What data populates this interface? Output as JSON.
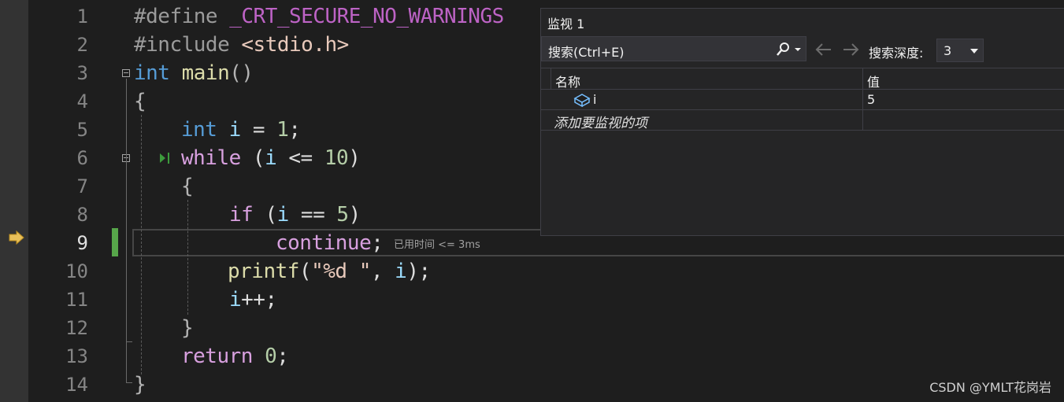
{
  "editor": {
    "line_numbers": [
      "1",
      "2",
      "3",
      "4",
      "5",
      "6",
      "7",
      "8",
      "9",
      "10",
      "11",
      "12",
      "13",
      "14"
    ],
    "current_line": "9",
    "code": {
      "l1_directive": "#define",
      "l1_macro": "_CRT_SECURE_NO_WARNINGS",
      "l2_directive": "#include",
      "l2_header": "<stdio.h>",
      "l3_type": "int",
      "l3_fn": "main",
      "l3_parens": "()",
      "l4": "{",
      "l5_type": "int",
      "l5_var": "i",
      "l5_eq": " = ",
      "l5_num": "1",
      "l5_semi": ";",
      "l6_kw": "while",
      "l6_open": " (",
      "l6_var": "i",
      "l6_op": " <= ",
      "l6_num": "10",
      "l6_close": ")",
      "l7": "{",
      "l8_kw": "if",
      "l8_open": " (",
      "l8_var": "i",
      "l8_op": " == ",
      "l8_num": "5",
      "l8_close": ")",
      "l9_kw": "continue",
      "l9_semi": ";",
      "l10_fn": "printf",
      "l10_open": "(",
      "l10_str": "\"%d \"",
      "l10_comma": ", ",
      "l10_var": "i",
      "l10_close": ");",
      "l11_var": "i",
      "l11_rest": "++;",
      "l12": "}",
      "l13_kw": "return",
      "l13_sp": " ",
      "l13_num": "0",
      "l13_semi": ";",
      "l14": "}"
    },
    "perf_tip": "已用时间 <= 3ms"
  },
  "watch": {
    "title": "监视 1",
    "search_placeholder": "搜索(Ctrl+E)",
    "depth_label": "搜索深度:",
    "depth_value": "3",
    "col_name": "名称",
    "col_value": "值",
    "rows": [
      {
        "name": "i",
        "value": "5"
      }
    ],
    "add_item": "添加要监视的项"
  },
  "watermark": "CSDN @YMLT花岗岩",
  "icons": {
    "exec": "execution-arrow-icon",
    "search": "search-icon",
    "back": "arrow-left-icon",
    "forward": "arrow-right-icon",
    "var": "variable-icon",
    "run_to_click": "run-to-click-icon"
  }
}
